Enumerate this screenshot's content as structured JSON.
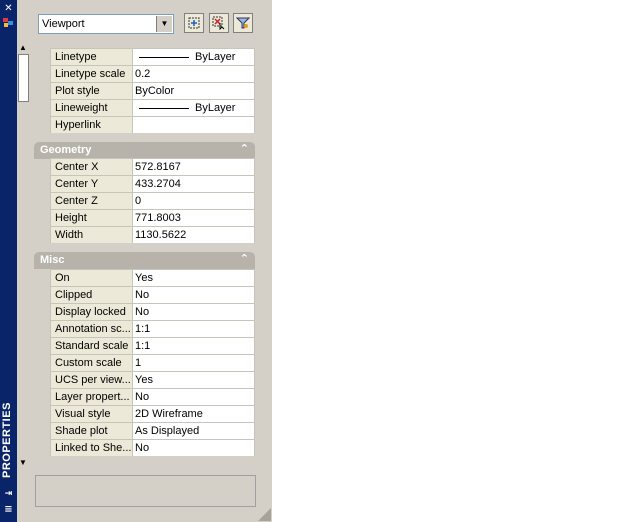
{
  "titlebar": {
    "label": "PROPERTIES",
    "close_glyph": "✕",
    "autohide_glyph": "⇥",
    "menu_glyph": "≡"
  },
  "selector": {
    "value": "Viewport",
    "arrow_glyph": "▼"
  },
  "toolbar": {
    "quick_select_icon": "quick-select-icon",
    "select_objects_icon": "select-objects-icon",
    "pickadd_icon": "toggle-pickadd-icon"
  },
  "general": {
    "rows": [
      {
        "name": "Linetype",
        "value": "ByLayer",
        "has_line": true
      },
      {
        "name": "Linetype scale",
        "value": "0.2"
      },
      {
        "name": "Plot style",
        "value": "ByColor"
      },
      {
        "name": "Lineweight",
        "value": "ByLayer",
        "has_line": true
      },
      {
        "name": "Hyperlink",
        "value": ""
      }
    ]
  },
  "geometry": {
    "title": "Geometry",
    "rows": [
      {
        "name": "Center X",
        "value": "572.8167"
      },
      {
        "name": "Center Y",
        "value": "433.2704"
      },
      {
        "name": "Center Z",
        "value": "0"
      },
      {
        "name": "Height",
        "value": "771.8003"
      },
      {
        "name": "Width",
        "value": "1130.5622"
      }
    ]
  },
  "misc": {
    "title": "Misc",
    "rows": [
      {
        "name": "On",
        "value": "Yes"
      },
      {
        "name": "Clipped",
        "value": "No"
      },
      {
        "name": "Display locked",
        "value": "No"
      },
      {
        "name": "Annotation sc...",
        "value": "1:1"
      },
      {
        "name": "Standard scale",
        "value": "1:1"
      },
      {
        "name": "Custom scale",
        "value": "1"
      },
      {
        "name": "UCS per view...",
        "value": "Yes"
      },
      {
        "name": "Layer propert...",
        "value": "No"
      },
      {
        "name": "Visual style",
        "value": "2D Wireframe"
      },
      {
        "name": "Shade plot",
        "value": "As Displayed"
      },
      {
        "name": "Linked to She...",
        "value": "No"
      }
    ]
  },
  "colors": {
    "titlebar": "#0a246a",
    "section_header": "#b7b3ab",
    "panel": "#d4d0c8"
  }
}
